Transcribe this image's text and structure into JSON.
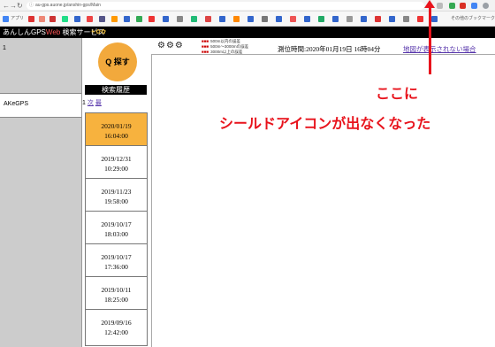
{
  "browser": {
    "back_glyph": "←",
    "forward_glyph": "→",
    "reload_glyph": "↻",
    "url": "au-gps.auone.jp/anshin-gps/Main",
    "lock_glyph": "ⓘ",
    "bookmark_apps_label": "アプリ",
    "bookmark_other_label": "その他のブックマーク"
  },
  "service": {
    "title_prefix": "あんしんGPS",
    "title_web": "Web",
    "title_suffix": " 検索サービス",
    "header_icons": "☀✿✿"
  },
  "left": {
    "number": "1",
    "device_name": "AKeGPS"
  },
  "search_button": {
    "label": "Q 探す"
  },
  "history": {
    "heading": "検索履歴",
    "pager_num": "1",
    "pager_link1": "次",
    "pager_link2": "最",
    "items": [
      {
        "date": "2020/01/19",
        "time": "16:04:00"
      },
      {
        "date": "2019/12/31",
        "time": "10:29:00"
      },
      {
        "date": "2019/11/23",
        "time": "19:58:00"
      },
      {
        "date": "2019/10/17",
        "time": "18:03:00"
      },
      {
        "date": "2019/10/17",
        "time": "17:36:00"
      },
      {
        "date": "2019/10/11",
        "time": "18:25:00"
      },
      {
        "date": "2019/09/16",
        "time": "12:42:00"
      }
    ]
  },
  "map_header": {
    "gear_icons": "⚙⚙⚙",
    "legend_line1": "500m以内の誤差",
    "legend_line2": "500m～3000mの誤差",
    "legend_line3": "3000m以上の誤差",
    "position_time": "測位時間:2020年01月19日 16時04分",
    "map_link": "地図が表示されない場合"
  },
  "annotation": {
    "line1": "ここに",
    "line2": "シールドアイコンが出なくなった",
    "color": "#e8131c"
  },
  "colors": {
    "accent_orange": "#f2a93c",
    "active_history": "#f7b23e",
    "link": "#5533aa"
  }
}
